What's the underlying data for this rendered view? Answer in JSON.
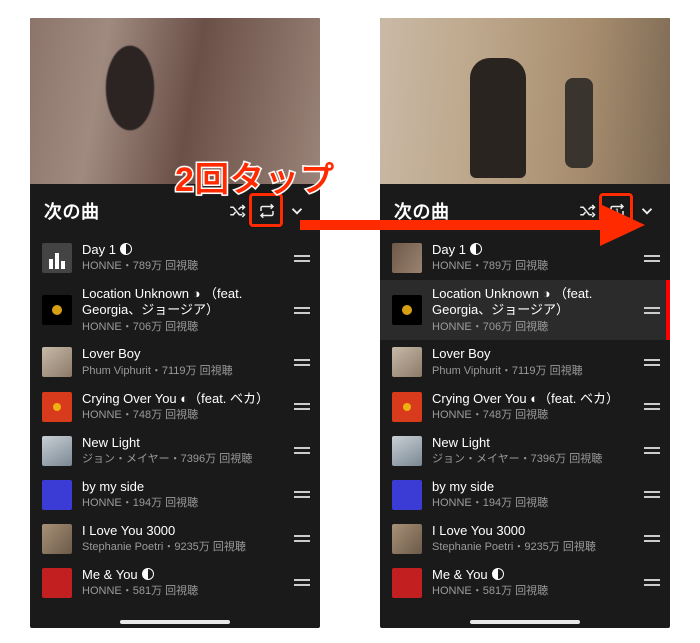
{
  "annotation": {
    "text": "2回タップ"
  },
  "phones": [
    {
      "header": {
        "title": "次の曲"
      },
      "repeat_state": "all",
      "tracks": [
        {
          "title": "Day 1",
          "moon": true,
          "sub": "HONNE・789万 回視聴",
          "thumb": "eq",
          "now_playing": true
        },
        {
          "title": "Location Unknown ◑ （feat. Georgia、ジョージア）",
          "moon": false,
          "sub": "HONNE・706万 回視聴",
          "thumb": "moon"
        },
        {
          "title": "Lover Boy",
          "moon": false,
          "sub": "Phum Viphurit・7119万 回視聴",
          "thumb": "lover"
        },
        {
          "title": "Crying Over You ◐（feat. ベカ）",
          "moon": false,
          "sub": "HONNE・748万 回視聴",
          "thumb": "cry"
        },
        {
          "title": "New Light",
          "moon": false,
          "sub": "ジョン・メイヤー・7396万 回視聴",
          "thumb": "newl"
        },
        {
          "title": "by my side",
          "moon": false,
          "sub": "HONNE・194万 回視聴",
          "thumb": "side"
        },
        {
          "title": "I Love You 3000",
          "moon": false,
          "sub": "Stephanie Poetri・9235万 回視聴",
          "thumb": "ily"
        },
        {
          "title": "Me & You",
          "moon": true,
          "sub": "HONNE・581万 回視聴",
          "thumb": "meu"
        }
      ]
    },
    {
      "header": {
        "title": "次の曲"
      },
      "repeat_state": "one",
      "tracks": [
        {
          "title": "Day 1",
          "moon": true,
          "sub": "HONNE・789万 回視聴",
          "thumb": "g02"
        },
        {
          "title": "Location Unknown ◑ （feat. Georgia、ジョージア）",
          "moon": false,
          "sub": "HONNE・706万 回視聴",
          "thumb": "moon",
          "selected": true
        },
        {
          "title": "Lover Boy",
          "moon": false,
          "sub": "Phum Viphurit・7119万 回視聴",
          "thumb": "lover"
        },
        {
          "title": "Crying Over You ◐（feat. ベカ）",
          "moon": false,
          "sub": "HONNE・748万 回視聴",
          "thumb": "cry"
        },
        {
          "title": "New Light",
          "moon": false,
          "sub": "ジョン・メイヤー・7396万 回視聴",
          "thumb": "newl"
        },
        {
          "title": "by my side",
          "moon": false,
          "sub": "HONNE・194万 回視聴",
          "thumb": "side"
        },
        {
          "title": "I Love You 3000",
          "moon": false,
          "sub": "Stephanie Poetri・9235万 回視聴",
          "thumb": "ily"
        },
        {
          "title": "Me & You",
          "moon": true,
          "sub": "HONNE・581万 回視聴",
          "thumb": "meu"
        }
      ]
    }
  ]
}
